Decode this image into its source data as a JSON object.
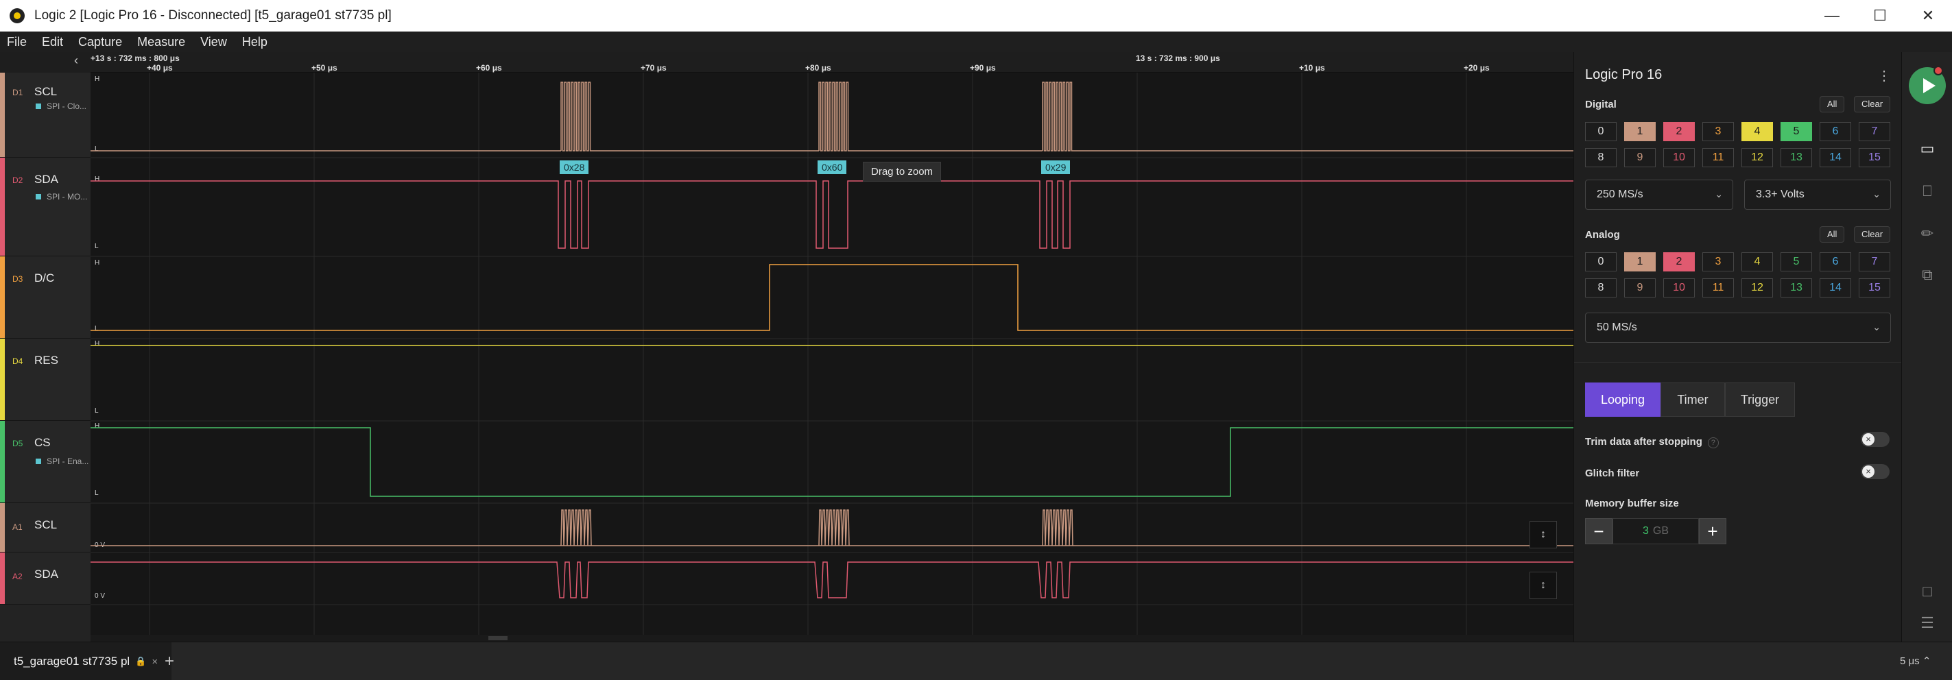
{
  "window": {
    "title": "Logic 2 [Logic Pro 16 - Disconnected] [t5_garage01 st7735 pl]"
  },
  "menu": [
    "File",
    "Edit",
    "Capture",
    "Measure",
    "View",
    "Help"
  ],
  "timeline": {
    "ticks": [
      "+13 s : 732 ms : 800 μs",
      "+40 μs",
      "+50 μs",
      "+60 μs",
      "+70 μs",
      "+80 μs",
      "+90 μs",
      "13 s : 732 ms : 900 μs",
      "+10 μs",
      "+20 μs"
    ]
  },
  "channels": [
    {
      "id": "D1",
      "name": "SCL",
      "sub": "SPI - Clo...",
      "color": "#c89880",
      "high": "H",
      "low": "L"
    },
    {
      "id": "D2",
      "name": "SDA",
      "sub": "SPI - MO...",
      "color": "#e05a70",
      "high": "H",
      "low": "L"
    },
    {
      "id": "D3",
      "name": "D/C",
      "sub": "",
      "color": "#f0a040",
      "high": "H",
      "low": "L"
    },
    {
      "id": "D4",
      "name": "RES",
      "sub": "",
      "color": "#e6d840",
      "high": "H",
      "low": "L"
    },
    {
      "id": "D5",
      "name": "CS",
      "sub": "SPI - Ena...",
      "color": "#48c068",
      "high": "H",
      "low": "L"
    },
    {
      "id": "A1",
      "name": "SCL",
      "sub": "",
      "color": "#c89880",
      "zero": "0 V"
    },
    {
      "id": "A2",
      "name": "SDA",
      "sub": "",
      "color": "#e05a70",
      "zero": "0 V"
    }
  ],
  "decodes": [
    "0x28",
    "0x60",
    "0x29"
  ],
  "tooltip": "Drag to zoom",
  "panel": {
    "device": "Logic Pro 16",
    "digital_label": "Digital",
    "analog_label": "Analog",
    "all_label": "All",
    "clear_label": "Clear",
    "channel_numbers": [
      "0",
      "1",
      "2",
      "3",
      "4",
      "5",
      "6",
      "7",
      "8",
      "9",
      "10",
      "11",
      "12",
      "13",
      "14",
      "15"
    ],
    "channel_colors": [
      "#dddddd",
      "#c89880",
      "#e05a70",
      "#f0a040",
      "#e6d840",
      "#48c068",
      "#4aa8e0",
      "#9a80e8",
      "#dddddd",
      "#c89880",
      "#e05a70",
      "#f0a040",
      "#e6d840",
      "#48c068",
      "#4aa8e0",
      "#9a80e8"
    ],
    "digital_enabled": [
      1,
      2,
      4,
      5
    ],
    "analog_enabled": [
      1,
      2
    ],
    "digital_rate": "250 MS/s",
    "voltage": "3.3+ Volts",
    "analog_rate": "50 MS/s",
    "modes": [
      "Looping",
      "Timer",
      "Trigger"
    ],
    "active_mode": "Looping",
    "trim_label": "Trim data after stopping",
    "trim_help": "?",
    "glitch_label": "Glitch filter",
    "buffer_label": "Memory buffer size",
    "buffer_value": "3",
    "buffer_unit": "GB",
    "minus": "−",
    "plus": "+"
  },
  "bottom": {
    "tab_name": "t5_garage01 st7735 pl",
    "lock": "🔒",
    "close": "×",
    "add": "+",
    "zoom": "5 μs ⌃"
  },
  "colors": {
    "accent": "#6c49d6",
    "run": "#3c9b5c",
    "decode": "#5cc6d0"
  }
}
